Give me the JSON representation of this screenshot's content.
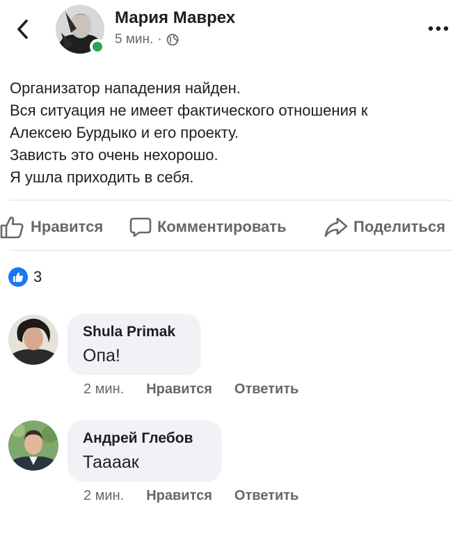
{
  "post": {
    "author": "Мария Маврех",
    "time": "5 мин.",
    "separator": "·",
    "lines": [
      "Организатор нападения найден.",
      "Вся ситуация не имеет фактического отношения к",
      "Алексею Бурдыко и его проекту.",
      "Зависть это очень нехорошо.",
      "Я ушла приходить в себя."
    ]
  },
  "actions": {
    "like": "Нравится",
    "comment": "Комментировать",
    "share": "Поделиться"
  },
  "reactions": {
    "count": "3",
    "icon": "thumbs-up-icon",
    "color": "#1877f2"
  },
  "comments": [
    {
      "author": "Shula Primak",
      "text": "Опа!",
      "time": "2 мин.",
      "like": "Нравится",
      "reply": "Ответить"
    },
    {
      "author": "Андрей Глебов",
      "text": "Тааaак",
      "time": "2 мин.",
      "like": "Нравится",
      "reply": "Ответить"
    }
  ],
  "colors": {
    "online": "#31a24c",
    "secondary_text": "#65676b",
    "bubble": "#f0f2f5"
  }
}
